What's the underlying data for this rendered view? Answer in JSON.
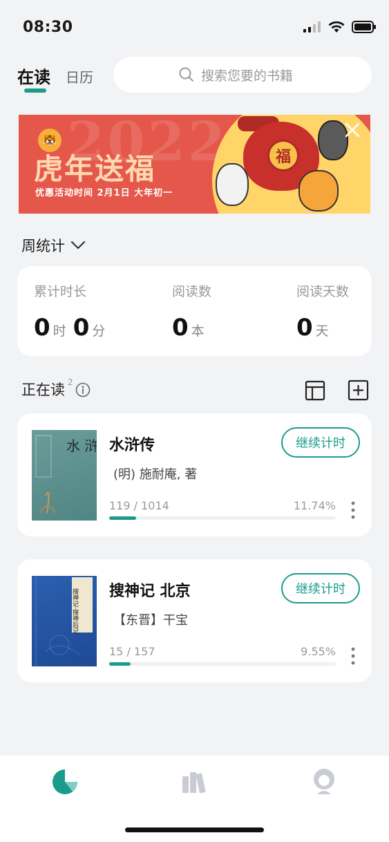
{
  "status": {
    "time": "08:30"
  },
  "header": {
    "tab_reading": "在读",
    "tab_calendar": "日历",
    "search_placeholder": "搜索您要的书籍"
  },
  "banner": {
    "bg_year": "2022",
    "title": "虎年送福",
    "subtitle": "优惠活动时间 2月1日 大年初一",
    "fu": "福"
  },
  "weekly": {
    "title": "周统计",
    "stats": [
      {
        "label": "累计时长",
        "hours": "0",
        "hours_unit": "时",
        "minutes": "0",
        "minutes_unit": "分"
      },
      {
        "label": "阅读数",
        "value": "0",
        "unit": "本"
      },
      {
        "label": "阅读天数",
        "value": "0",
        "unit": "天"
      }
    ]
  },
  "reading": {
    "title": "正在读",
    "count": "2",
    "books": [
      {
        "title": "水浒传",
        "author": "(明) 施耐庵, 著",
        "button": "继续计时",
        "progress": "119 / 1014",
        "percent": "11.74%",
        "fraction": 0.1174,
        "cover_text": "水 浒 传"
      },
      {
        "title": "搜神记 北京",
        "author": "【东晋】干宝",
        "button": "继续计时",
        "progress": "15 / 157",
        "percent": "9.55%",
        "fraction": 0.0955,
        "cover_text": "搜神记·搜神后记"
      }
    ]
  },
  "colors": {
    "accent": "#1a9c8c",
    "banner": "#e4574a",
    "background": "#f2f3f5"
  },
  "tabbar": {
    "items": [
      "stats-icon",
      "bookshelf-icon",
      "profile-icon"
    ]
  }
}
